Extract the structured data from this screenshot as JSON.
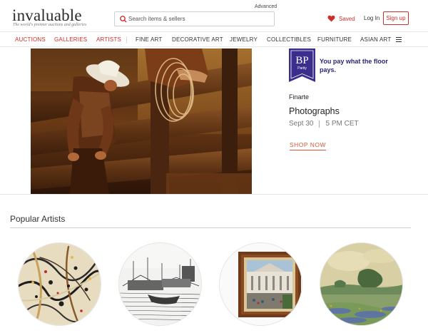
{
  "header": {
    "logo_text": "invaluable",
    "tagline": "The world's premier auctions and galleries",
    "advanced_label": "Advanced",
    "search_placeholder": "Search items & sellers",
    "saved_label": "Saved",
    "login_label": "Log In",
    "signup_label": "Sign up"
  },
  "nav": {
    "items": [
      "AUCTIONS",
      "GALLERIES",
      "ARTISTS",
      "FINE ART",
      "DECORATIVE ART",
      "JEWELRY",
      "COLLECTIBLES",
      "FURNITURE",
      "ASIAN ART"
    ]
  },
  "hero": {
    "badge_text": "BP",
    "badge_subtext": "Parity",
    "parity_message": "You pay what the floor pays.",
    "auction_house": "Finarte",
    "sale_title": "Photographs",
    "sale_date": "Sept 30",
    "sale_time": "5 PM CET",
    "cta_label": "SHOP NOW",
    "slide_count": 4,
    "active_slide": 3
  },
  "popular_artists": {
    "title": "Popular Artists"
  },
  "colors": {
    "brand_red": "#c9302c",
    "parity_purple": "#2b2577",
    "cta_orange": "#d05a3a"
  }
}
